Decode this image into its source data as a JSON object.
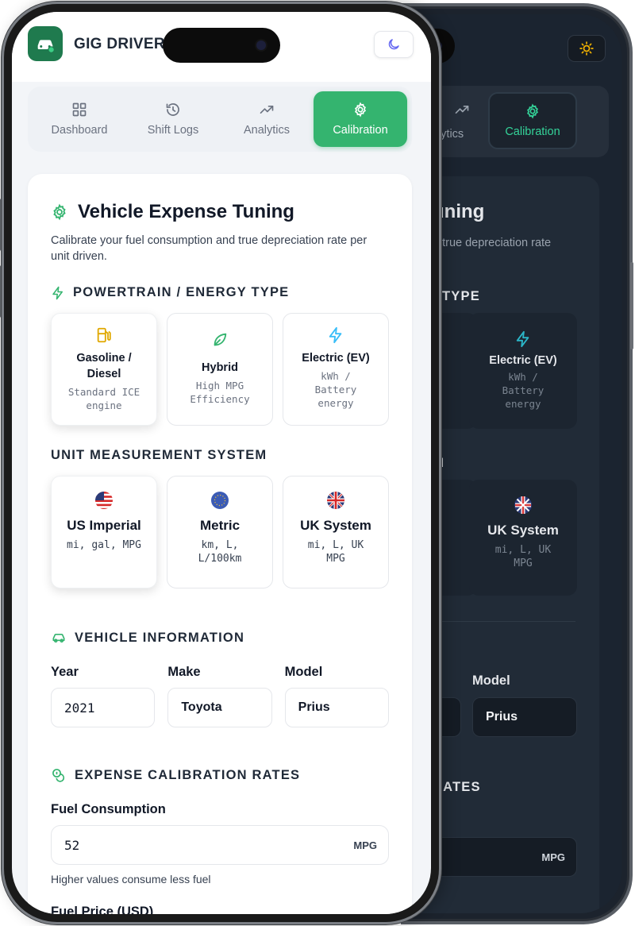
{
  "app": {
    "name": "GIG DRIVER"
  },
  "nav": {
    "tabs": [
      {
        "label": "Dashboard",
        "icon": "grid-icon"
      },
      {
        "label": "Shift Logs",
        "icon": "history-icon"
      },
      {
        "label": "Analytics",
        "icon": "trend-icon"
      },
      {
        "label": "Calibration",
        "icon": "gear-icon",
        "active": true
      }
    ]
  },
  "page": {
    "title": "Vehicle Expense Tuning",
    "subtitle": "Calibrate your fuel consumption and true depreciation rate per unit driven."
  },
  "powertrain": {
    "heading": "POWERTRAIN / ENERGY TYPE",
    "options": [
      {
        "title": "Gasoline / Diesel",
        "desc": "Standard ICE engine",
        "selected": true
      },
      {
        "title": "Hybrid",
        "desc": "High MPG Efficiency"
      },
      {
        "title": "Electric (EV)",
        "desc": "kWh / Battery energy"
      }
    ]
  },
  "units": {
    "heading": "UNIT MEASUREMENT SYSTEM",
    "options": [
      {
        "title": "US Imperial",
        "desc": "mi, gal, MPG",
        "selected": true
      },
      {
        "title": "Metric",
        "desc": "km, L, L/100km"
      },
      {
        "title": "UK System",
        "desc": "mi, L, UK MPG"
      }
    ]
  },
  "vehicle": {
    "heading": "VEHICLE INFORMATION",
    "labels": {
      "year": "Year",
      "make": "Make",
      "model": "Model"
    },
    "values": {
      "year": "2021",
      "make": "Toyota",
      "model": "Prius"
    }
  },
  "expense": {
    "heading": "EXPENSE CALIBRATION RATES",
    "fuel_label": "Fuel Consumption",
    "fuel_value": "52",
    "fuel_unit": "MPG",
    "fuel_hint": "Higher values consume less fuel",
    "price_label": "Fuel Price (USD)"
  },
  "dark_preview": {
    "nav_analytics": "nalytics",
    "nav_calibration": "Calibration",
    "title_fragment": "uning",
    "subtitle_fragment": "d true depreciation rate",
    "powertrain_fragment": "TYPE",
    "ev_title": "Electric (EV)",
    "ev_desc": "kWh / Battery energy",
    "units_fragment": "EM",
    "uk_title": "UK System",
    "uk_desc": "mi, L, UK MPG",
    "model_label": "Model",
    "model_value": "Prius",
    "rates_fragment": "RATES",
    "fuel_unit": "MPG"
  },
  "colors": {
    "accent": "#34b46f",
    "brand": "#1f7a4e",
    "dark_accent": "#34d399"
  }
}
